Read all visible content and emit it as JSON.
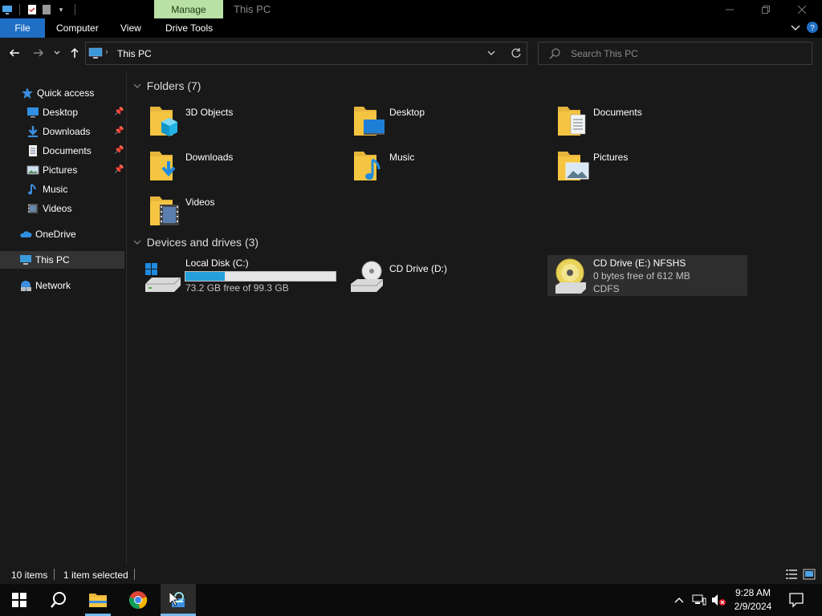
{
  "window": {
    "title": "This PC",
    "context_tab": "Manage"
  },
  "ribbon": {
    "tabs": [
      "File",
      "Computer",
      "View",
      "Drive Tools"
    ]
  },
  "address": {
    "path": "This PC",
    "search_placeholder": "Search This PC"
  },
  "nav": {
    "quick_access": "Quick access",
    "items": [
      {
        "label": "Desktop",
        "icon": "desktop-icon",
        "pinned": true
      },
      {
        "label": "Downloads",
        "icon": "downloads-icon",
        "pinned": true
      },
      {
        "label": "Documents",
        "icon": "documents-icon",
        "pinned": true
      },
      {
        "label": "Pictures",
        "icon": "pictures-icon",
        "pinned": true
      },
      {
        "label": "Music",
        "icon": "music-icon",
        "pinned": false
      },
      {
        "label": "Videos",
        "icon": "videos-icon",
        "pinned": false
      }
    ],
    "onedrive": "OneDrive",
    "this_pc": "This PC",
    "network": "Network"
  },
  "folders": {
    "header": "Folders (7)",
    "items": [
      {
        "label": "3D Objects",
        "overlay": "cube"
      },
      {
        "label": "Desktop",
        "overlay": "desktop"
      },
      {
        "label": "Documents",
        "overlay": "doc"
      },
      {
        "label": "Downloads",
        "overlay": "download"
      },
      {
        "label": "Music",
        "overlay": "music"
      },
      {
        "label": "Pictures",
        "overlay": "picture"
      },
      {
        "label": "Videos",
        "overlay": "video"
      }
    ]
  },
  "drives": {
    "header": "Devices and drives (3)",
    "items": [
      {
        "label": "Local Disk (C:)",
        "free": "73.2 GB free of 99.3 GB",
        "used_fraction": 0.263
      },
      {
        "label": "CD Drive (D:)"
      },
      {
        "label": "CD Drive (E:) NFSHS",
        "free": "0 bytes free of 612 MB",
        "fs": "CDFS"
      }
    ]
  },
  "status": {
    "items_count": "10 items",
    "selected": "1 item selected"
  },
  "clock": {
    "time": "9:28 AM",
    "date": "2/9/2024"
  },
  "colors": {
    "accent": "#1f6fc5",
    "manage_tab": "#b9e0a5",
    "folder": "#f5c542",
    "progress": "#26a0da"
  }
}
